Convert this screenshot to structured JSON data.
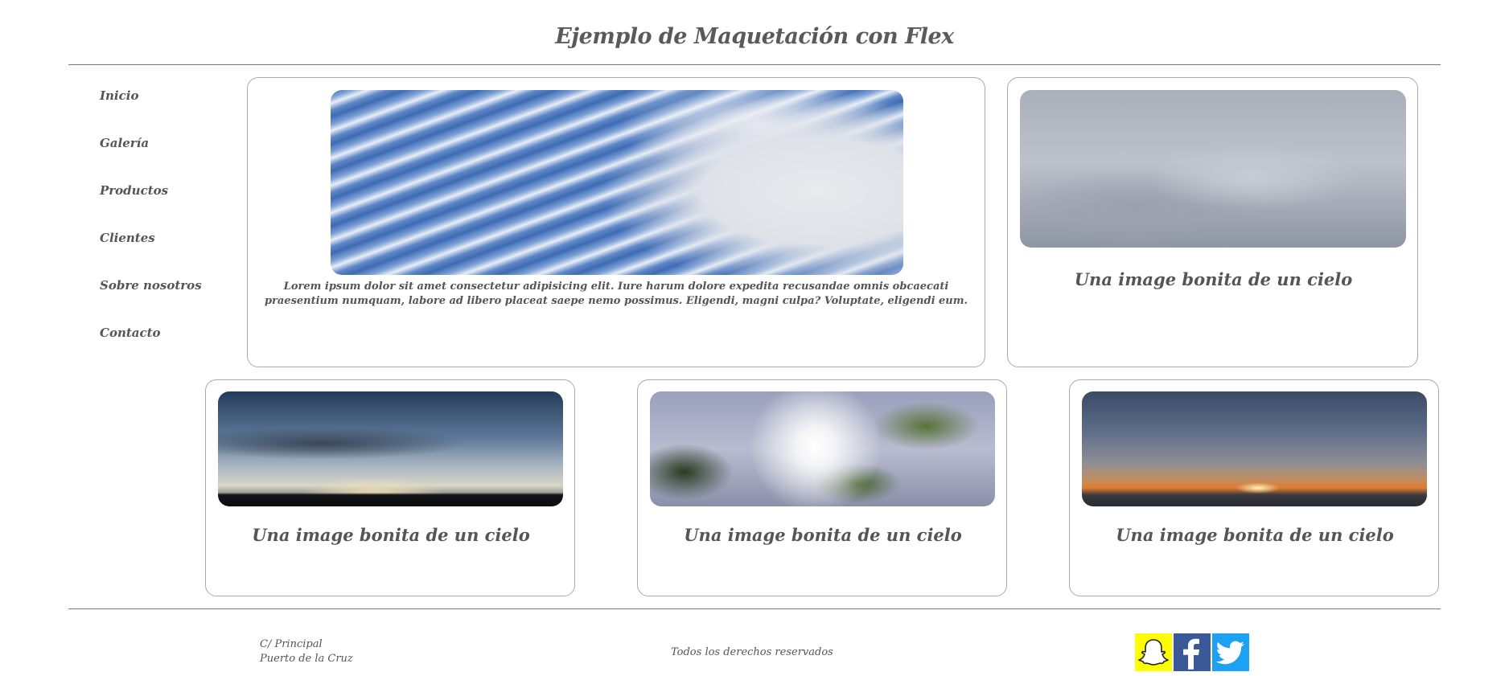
{
  "header": {
    "title": "Ejemplo de Maquetación con Flex"
  },
  "nav": {
    "items": [
      {
        "label": "Inicio"
      },
      {
        "label": "Galería"
      },
      {
        "label": "Productos"
      },
      {
        "label": "Clientes"
      },
      {
        "label": "Sobre nosotros"
      },
      {
        "label": "Contacto"
      }
    ]
  },
  "main_card": {
    "text": "Lorem ipsum dolor sit amet consectetur adipisicing elit. Iure harum dolore expedita recusandae omnis obcaecati praesentium numquam, labore ad libero placeat saepe nemo possimus. Eligendi, magni culpa? Voluptate, eligendi eum."
  },
  "cards": [
    {
      "caption": "Una image bonita de un cielo"
    },
    {
      "caption": "Una image bonita de un cielo"
    },
    {
      "caption": "Una image bonita de un cielo"
    },
    {
      "caption": "Una image bonita de un cielo"
    }
  ],
  "footer": {
    "address_line1": "C/ Principal",
    "address_line2": "Puerto de la Cruz",
    "rights": "Todos los derechos reservados",
    "social": [
      {
        "icon": "snapchat-icon",
        "color": "#fffc00"
      },
      {
        "icon": "facebook-icon",
        "color": "#3b5998"
      },
      {
        "icon": "twitter-icon",
        "color": "#1da1f2"
      }
    ]
  }
}
